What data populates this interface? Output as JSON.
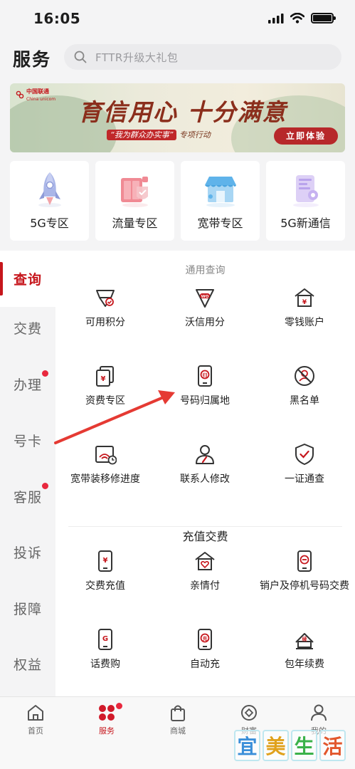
{
  "status_bar": {
    "time": "16:05"
  },
  "header": {
    "title": "服务",
    "search_placeholder": "FTTR升级大礼包"
  },
  "banner": {
    "brand_cn": "中国联通",
    "brand_en": "China unicom",
    "title": "育信用心 十分满意",
    "subtitle_highlight": "“我为群众办实事”",
    "subtitle_rest": "专项行动",
    "cta": "立即体验"
  },
  "zones": [
    {
      "label": "5G专区",
      "icon": "rocket-icon"
    },
    {
      "label": "流量专区",
      "icon": "data-traffic-icon"
    },
    {
      "label": "宽带专区",
      "icon": "broadband-store-icon"
    },
    {
      "label": "5G新通信",
      "icon": "new-communication-icon"
    }
  ],
  "sidenav": [
    {
      "label": "查询",
      "active": true,
      "badge": false
    },
    {
      "label": "交费",
      "active": false,
      "badge": false
    },
    {
      "label": "办理",
      "active": false,
      "badge": true
    },
    {
      "label": "号卡",
      "active": false,
      "badge": false
    },
    {
      "label": "客服",
      "active": false,
      "badge": true
    },
    {
      "label": "投诉",
      "active": false,
      "badge": false
    },
    {
      "label": "报障",
      "active": false,
      "badge": false
    },
    {
      "label": "权益",
      "active": false,
      "badge": false
    }
  ],
  "sections": {
    "general_query": {
      "title": "通用查询",
      "items": [
        {
          "label": "可用积分",
          "icon": "points-icon"
        },
        {
          "label": "沃信用分",
          "icon": "wo-credit-icon"
        },
        {
          "label": "零钱账户",
          "icon": "wallet-house-icon"
        },
        {
          "label": "资费专区",
          "icon": "tariff-cards-icon"
        },
        {
          "label": "号码归属地",
          "icon": "phone-location-icon"
        },
        {
          "label": "黑名单",
          "icon": "blacklist-icon"
        },
        {
          "label": "宽带装移修进度",
          "icon": "broadband-progress-icon"
        },
        {
          "label": "联系人修改",
          "icon": "contact-edit-icon"
        },
        {
          "label": "一证通查",
          "icon": "id-check-shield-icon"
        }
      ]
    },
    "recharge": {
      "title": "充值交费",
      "items": [
        {
          "label": "交费充值",
          "icon": "phone-yen-icon"
        },
        {
          "label": "亲情付",
          "icon": "family-pay-icon"
        },
        {
          "label": "销户及停机号码交费",
          "icon": "phone-minus-icon"
        },
        {
          "label": "话费购",
          "icon": "phone-g-icon"
        },
        {
          "label": "自动充",
          "icon": "auto-recharge-icon"
        },
        {
          "label": "包年续费",
          "icon": "annual-renew-icon"
        }
      ]
    }
  },
  "tabbar": [
    {
      "label": "首页",
      "icon": "home-icon",
      "active": false
    },
    {
      "label": "服务",
      "icon": "service-clover-icon",
      "active": true
    },
    {
      "label": "商城",
      "icon": "shopping-bag-icon",
      "active": false
    },
    {
      "label": "财富",
      "icon": "wealth-coin-icon",
      "active": false
    },
    {
      "label": "我的",
      "icon": "profile-icon",
      "active": false
    }
  ],
  "watermark": [
    "宜",
    "美",
    "生",
    "活"
  ],
  "colors": {
    "brand_red": "#c6161c",
    "badge_red": "#e8283e",
    "icon_dark": "#333333"
  }
}
